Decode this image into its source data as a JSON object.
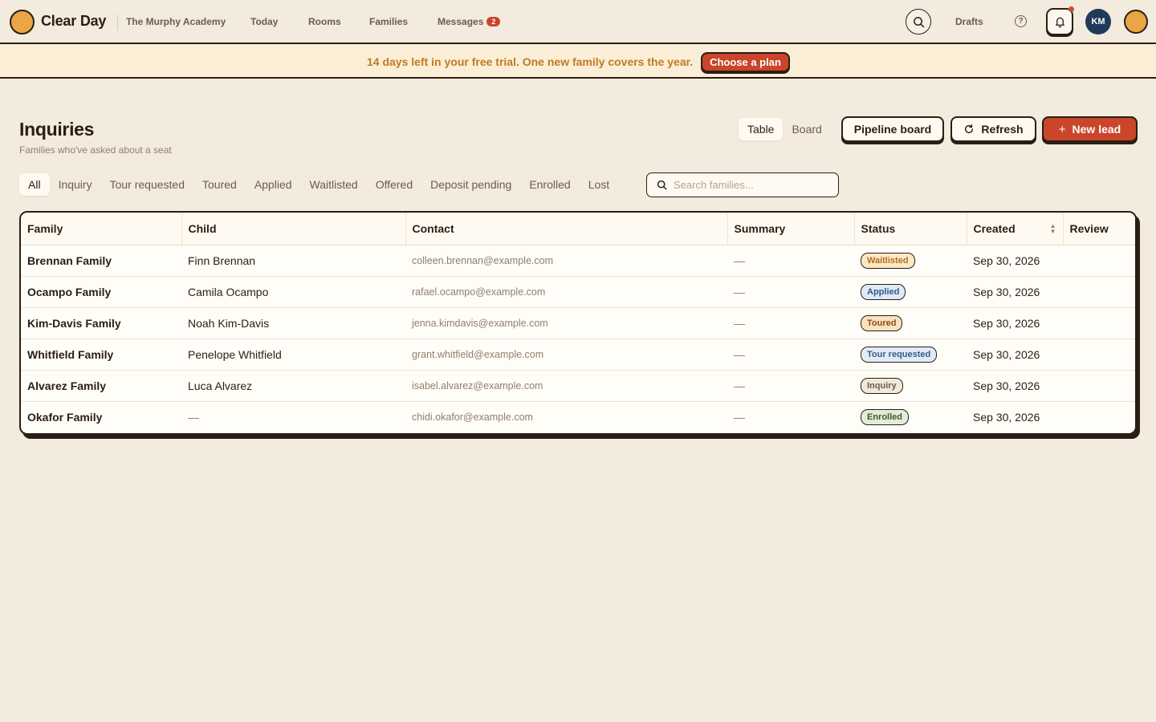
{
  "app": {
    "brand": "Clear Day",
    "school": "The Murphy Academy"
  },
  "nav": {
    "today": "Today",
    "rooms": "Rooms",
    "families": "Families",
    "messages": "Messages",
    "messages_count": "2",
    "drafts": "Drafts",
    "help": "?",
    "avatar_initials": "KM"
  },
  "banner": {
    "text": "14 days left in your free trial. One new family covers the year.",
    "cta": "Choose a plan"
  },
  "page": {
    "title": "Inquiries",
    "subtitle": "Families who've asked about a seat"
  },
  "view_toggle": {
    "table": "Table",
    "board": "Board"
  },
  "actions": {
    "pipeline": "Pipeline board",
    "refresh": "Refresh",
    "new_lead": "New lead"
  },
  "filters": {
    "all": "All",
    "inquiry": "Inquiry",
    "tour_requested": "Tour requested",
    "toured": "Toured",
    "applied": "Applied",
    "waitlisted": "Waitlisted",
    "offered": "Offered",
    "deposit_pending": "Deposit pending",
    "enrolled": "Enrolled",
    "lost": "Lost"
  },
  "search": {
    "placeholder": "Search families..."
  },
  "table": {
    "columns": {
      "family": "Family",
      "child": "Child",
      "contact": "Contact",
      "summary": "Summary",
      "status": "Status",
      "created": "Created",
      "review": "Review"
    },
    "rows": [
      {
        "family": "Brennan Family",
        "child": "Finn Brennan",
        "contact": "colleen.brennan@example.com",
        "summary": "—",
        "status": "Waitlisted",
        "created": "Sep 30, 2026"
      },
      {
        "family": "Ocampo Family",
        "child": "Camila Ocampo",
        "contact": "rafael.ocampo@example.com",
        "summary": "—",
        "status": "Applied",
        "created": "Sep 30, 2026"
      },
      {
        "family": "Kim-Davis Family",
        "child": "Noah Kim-Davis",
        "contact": "jenna.kimdavis@example.com",
        "summary": "—",
        "status": "Toured",
        "created": "Sep 30, 2026"
      },
      {
        "family": "Whitfield Family",
        "child": "Penelope Whitfield",
        "contact": "grant.whitfield@example.com",
        "summary": "—",
        "status": "Tour requested",
        "created": "Sep 30, 2026"
      },
      {
        "family": "Alvarez Family",
        "child": "Luca Alvarez",
        "contact": "isabel.alvarez@example.com",
        "summary": "—",
        "status": "Inquiry",
        "created": "Sep 30, 2026"
      },
      {
        "family": "Okafor Family",
        "child": "—",
        "contact": "chidi.okafor@example.com",
        "summary": "—",
        "status": "Enrolled",
        "created": "Sep 30, 2026"
      }
    ]
  },
  "colors": {
    "background": "#f3ebdd",
    "accent": "#c9462a",
    "brand": "#eba544",
    "ink": "#2a1e14"
  }
}
